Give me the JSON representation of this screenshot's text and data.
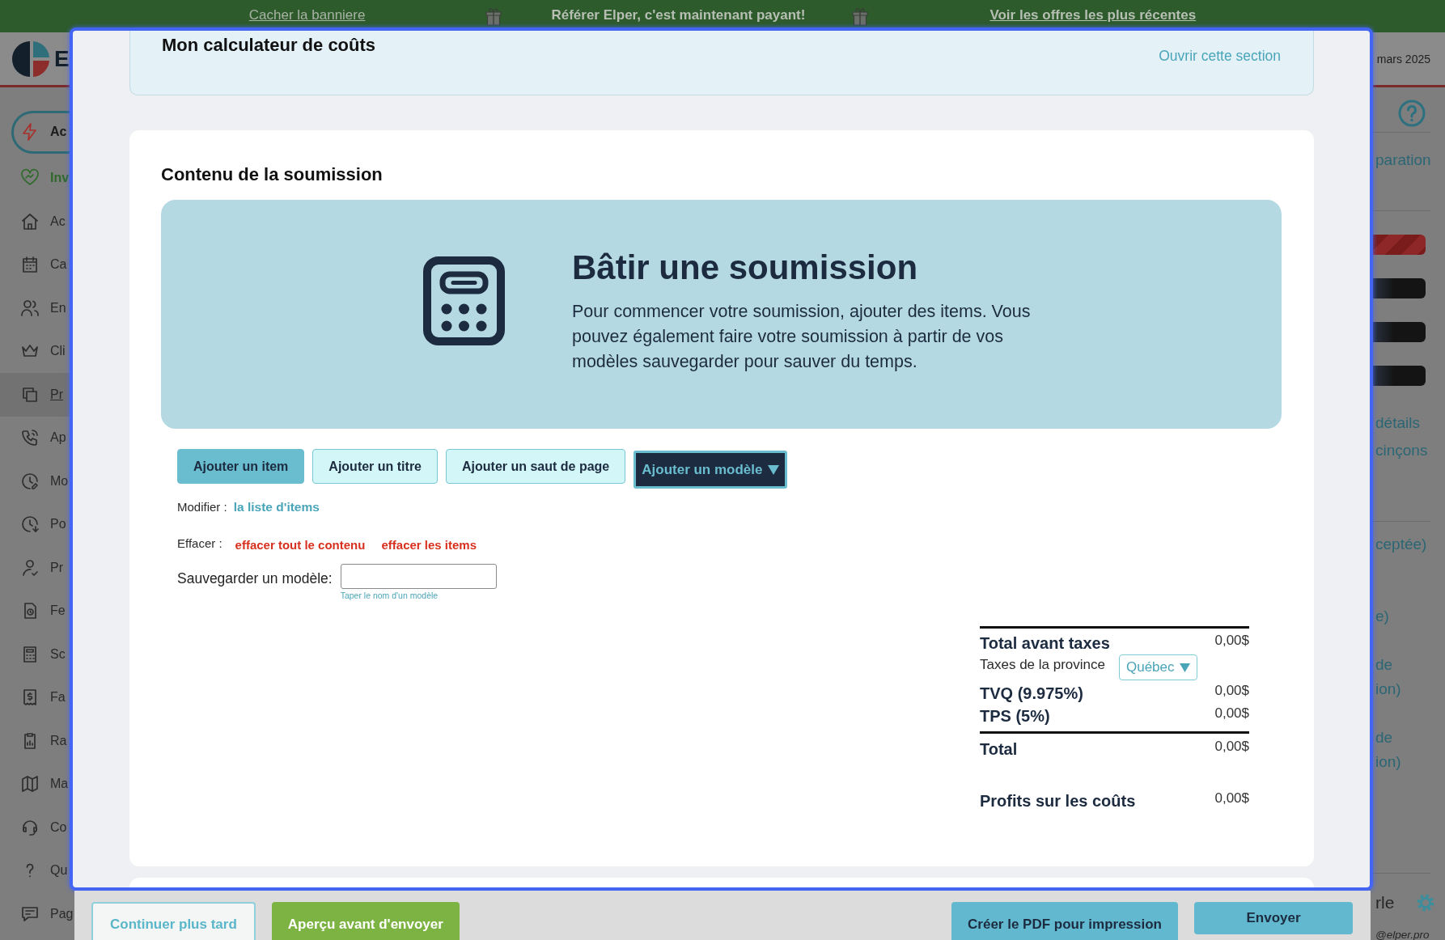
{
  "banner": {
    "hide_link": "Cacher la banniere",
    "message": "Référer Elper, c'est maintenant payant!",
    "offers_link": "Voir les offres les plus récentes"
  },
  "header": {
    "logo_text": "E",
    "date": "mars 2025"
  },
  "sidebar": {
    "items": [
      {
        "label": "Ac",
        "kind": "primary",
        "selected": false
      },
      {
        "label": "Inv",
        "kind": "featured",
        "selected": false
      },
      {
        "label": "Ac",
        "kind": "link",
        "selected": false
      },
      {
        "label": "Ca",
        "kind": "link",
        "selected": false
      },
      {
        "label": "En",
        "kind": "link",
        "selected": false
      },
      {
        "label": "Cli",
        "kind": "link",
        "selected": false
      },
      {
        "label": "Pr",
        "kind": "link",
        "selected": true
      },
      {
        "label": "Ap",
        "kind": "link",
        "selected": false
      },
      {
        "label": "Mo",
        "kind": "link",
        "selected": false
      },
      {
        "label": "Po",
        "kind": "link",
        "selected": false
      },
      {
        "label": "Pr",
        "kind": "link",
        "selected": false
      },
      {
        "label": "Fe",
        "kind": "link",
        "selected": false
      },
      {
        "label": "Sc",
        "kind": "link",
        "selected": false
      },
      {
        "label": "Fa",
        "kind": "link",
        "selected": false
      },
      {
        "label": "Ra",
        "kind": "link",
        "selected": false
      },
      {
        "label": "Ma",
        "kind": "link",
        "selected": false
      },
      {
        "label": "Co",
        "kind": "link",
        "selected": false
      },
      {
        "label": "Qu",
        "kind": "link",
        "selected": false
      },
      {
        "label": "Pag",
        "kind": "link",
        "selected": false
      }
    ]
  },
  "right_panel": {
    "title_fragment": "paration",
    "action_bars": [
      {
        "kind": "danger"
      },
      {
        "kind": "dark"
      },
      {
        "kind": "dark"
      },
      {
        "kind": "dark"
      }
    ],
    "detail_lines": [
      "détails",
      "cinçons"
    ],
    "entries": [
      {
        "lines": [
          "ceptée)"
        ]
      },
      {
        "lines": [
          "e)"
        ]
      },
      {
        "lines": [
          "de",
          "ion)"
        ]
      },
      {
        "lines": [
          "de",
          "ion)"
        ]
      }
    ],
    "footer_text": "rle",
    "email_fragment": "@elper.pro"
  },
  "modal": {
    "cost_calculator": {
      "title": "Mon calculateur de coûts",
      "open_link": "Ouvrir cette section"
    },
    "content": {
      "title": "Contenu de la soumission",
      "empty_state": {
        "heading": "Bâtir une soumission",
        "text": "Pour commencer votre soumission, ajouter des items. Vous pouvez également faire votre soumission à partir de vos modèles sauvegarder pour sauver du temps."
      },
      "add_buttons": [
        {
          "label": "Ajouter un item",
          "kind": "primary"
        },
        {
          "label": "Ajouter un titre",
          "kind": "secondary"
        },
        {
          "label": "Ajouter un saut de page",
          "kind": "secondary"
        },
        {
          "label": "Ajouter un modèle",
          "kind": "dropdown"
        }
      ],
      "modify": {
        "label": "Modifier :",
        "link": "la liste d'items"
      },
      "clear": {
        "label": "Effacer :",
        "links": [
          "effacer tout le contenu",
          "effacer les items"
        ]
      },
      "save_template": {
        "label": "Sauvegarder un modèle:",
        "caption": "Taper le nom d'un modèle"
      },
      "totals": [
        {
          "label": "Total avant taxes",
          "value": "0,00$",
          "kind": "subtotal"
        },
        {
          "label": "Taxes de la province",
          "kind": "province",
          "select": "Québec"
        },
        {
          "label": "TVQ (9.975%)",
          "value": "0,00$",
          "kind": "tax"
        },
        {
          "label": "TPS (5%)",
          "value": "0,00$",
          "kind": "tax"
        },
        {
          "label": "Total",
          "value": "0,00$",
          "kind": "total"
        },
        {
          "label": "Profits sur les coûts",
          "value": "0,00$",
          "kind": "profit"
        }
      ]
    }
  },
  "footer": {
    "left_buttons": [
      {
        "label": "Continuer plus tard",
        "kind": "outline"
      },
      {
        "label": "Aperçu avant d'envoyer",
        "kind": "success"
      }
    ],
    "right_buttons": [
      {
        "label": "Créer le PDF pour impression",
        "kind": "info"
      },
      {
        "label": "Envoyer",
        "kind": "compact"
      }
    ]
  }
}
